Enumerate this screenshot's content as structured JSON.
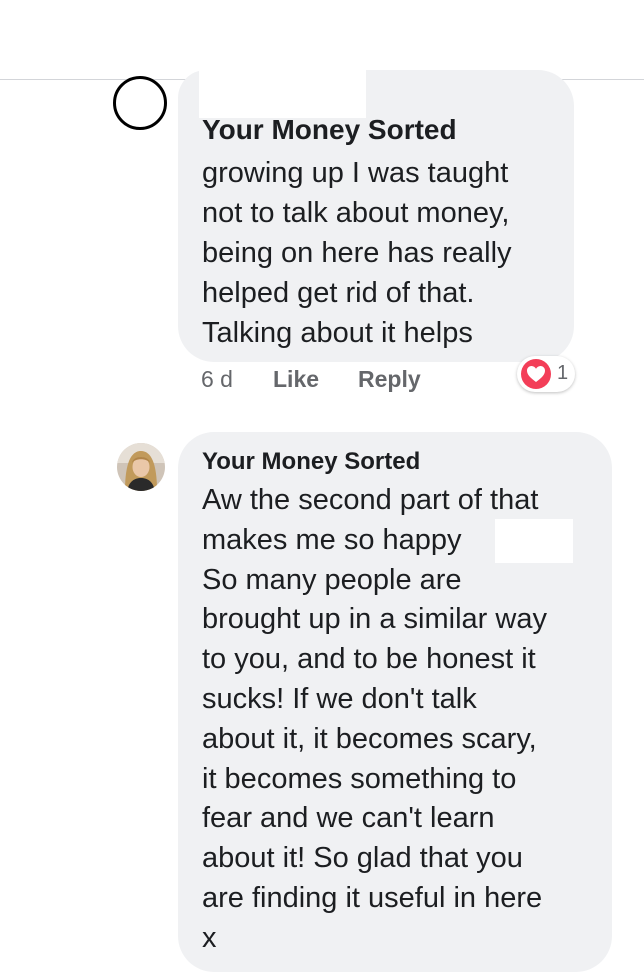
{
  "thread": {
    "comments": [
      {
        "author": "Your Money Sorted",
        "text": "growing up I was taught\nnot to talk about money,\nbeing on here has really\nhelped get rid of that.\nTalking about it helps",
        "time": "6 d",
        "like_label": "Like",
        "reply_label": "Reply",
        "reaction": {
          "icon": "heart-icon",
          "count": "1",
          "color": "#f33e58"
        }
      },
      {
        "author": "Your Money Sorted",
        "text": "Aw the second part of that\nmakes me so happy\nSo many people are\nbrought up in a similar way\nto you, and to be honest it\nsucks! If we don't talk\nabout it, it becomes scary,\nit becomes something to\nfear and we can't learn\nabout it!  So glad that you\nare finding it useful in here\nx"
      }
    ]
  },
  "colors": {
    "bubble_bg": "#f0f1f3",
    "meta_text": "#65676b",
    "body_text": "#1c1e21",
    "heart": "#f33e58"
  }
}
